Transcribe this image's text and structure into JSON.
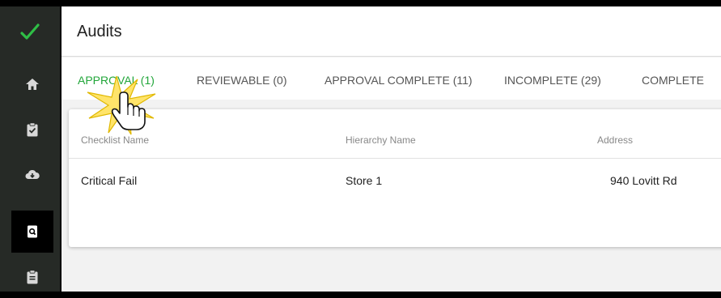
{
  "header": {
    "title": "Audits"
  },
  "sidebar": {
    "logo_icon": "checkmark-logo-icon",
    "items": [
      {
        "icon": "home-icon"
      },
      {
        "icon": "clipboard-check-icon"
      },
      {
        "icon": "cloud-download-icon"
      },
      {
        "icon": "document-search-icon",
        "active": true
      },
      {
        "icon": "clipboard-list-icon"
      }
    ]
  },
  "tabs": [
    {
      "label": "APPROVAL (1)",
      "active": true
    },
    {
      "label": "REVIEWABLE (0)"
    },
    {
      "label": "APPROVAL COMPLETE (11)"
    },
    {
      "label": "INCOMPLETE (29)"
    },
    {
      "label": "COMPLETE"
    }
  ],
  "table": {
    "columns": [
      "Checklist Name",
      "Hierarchy Name",
      "Address"
    ],
    "rows": [
      {
        "checklist": "Critical Fail",
        "hierarchy": "Store 1",
        "address": "940 Lovitt Rd"
      }
    ]
  },
  "colors": {
    "accent": "#22a63a",
    "sidebar": "#262a26",
    "background": "#f2f2f2"
  }
}
